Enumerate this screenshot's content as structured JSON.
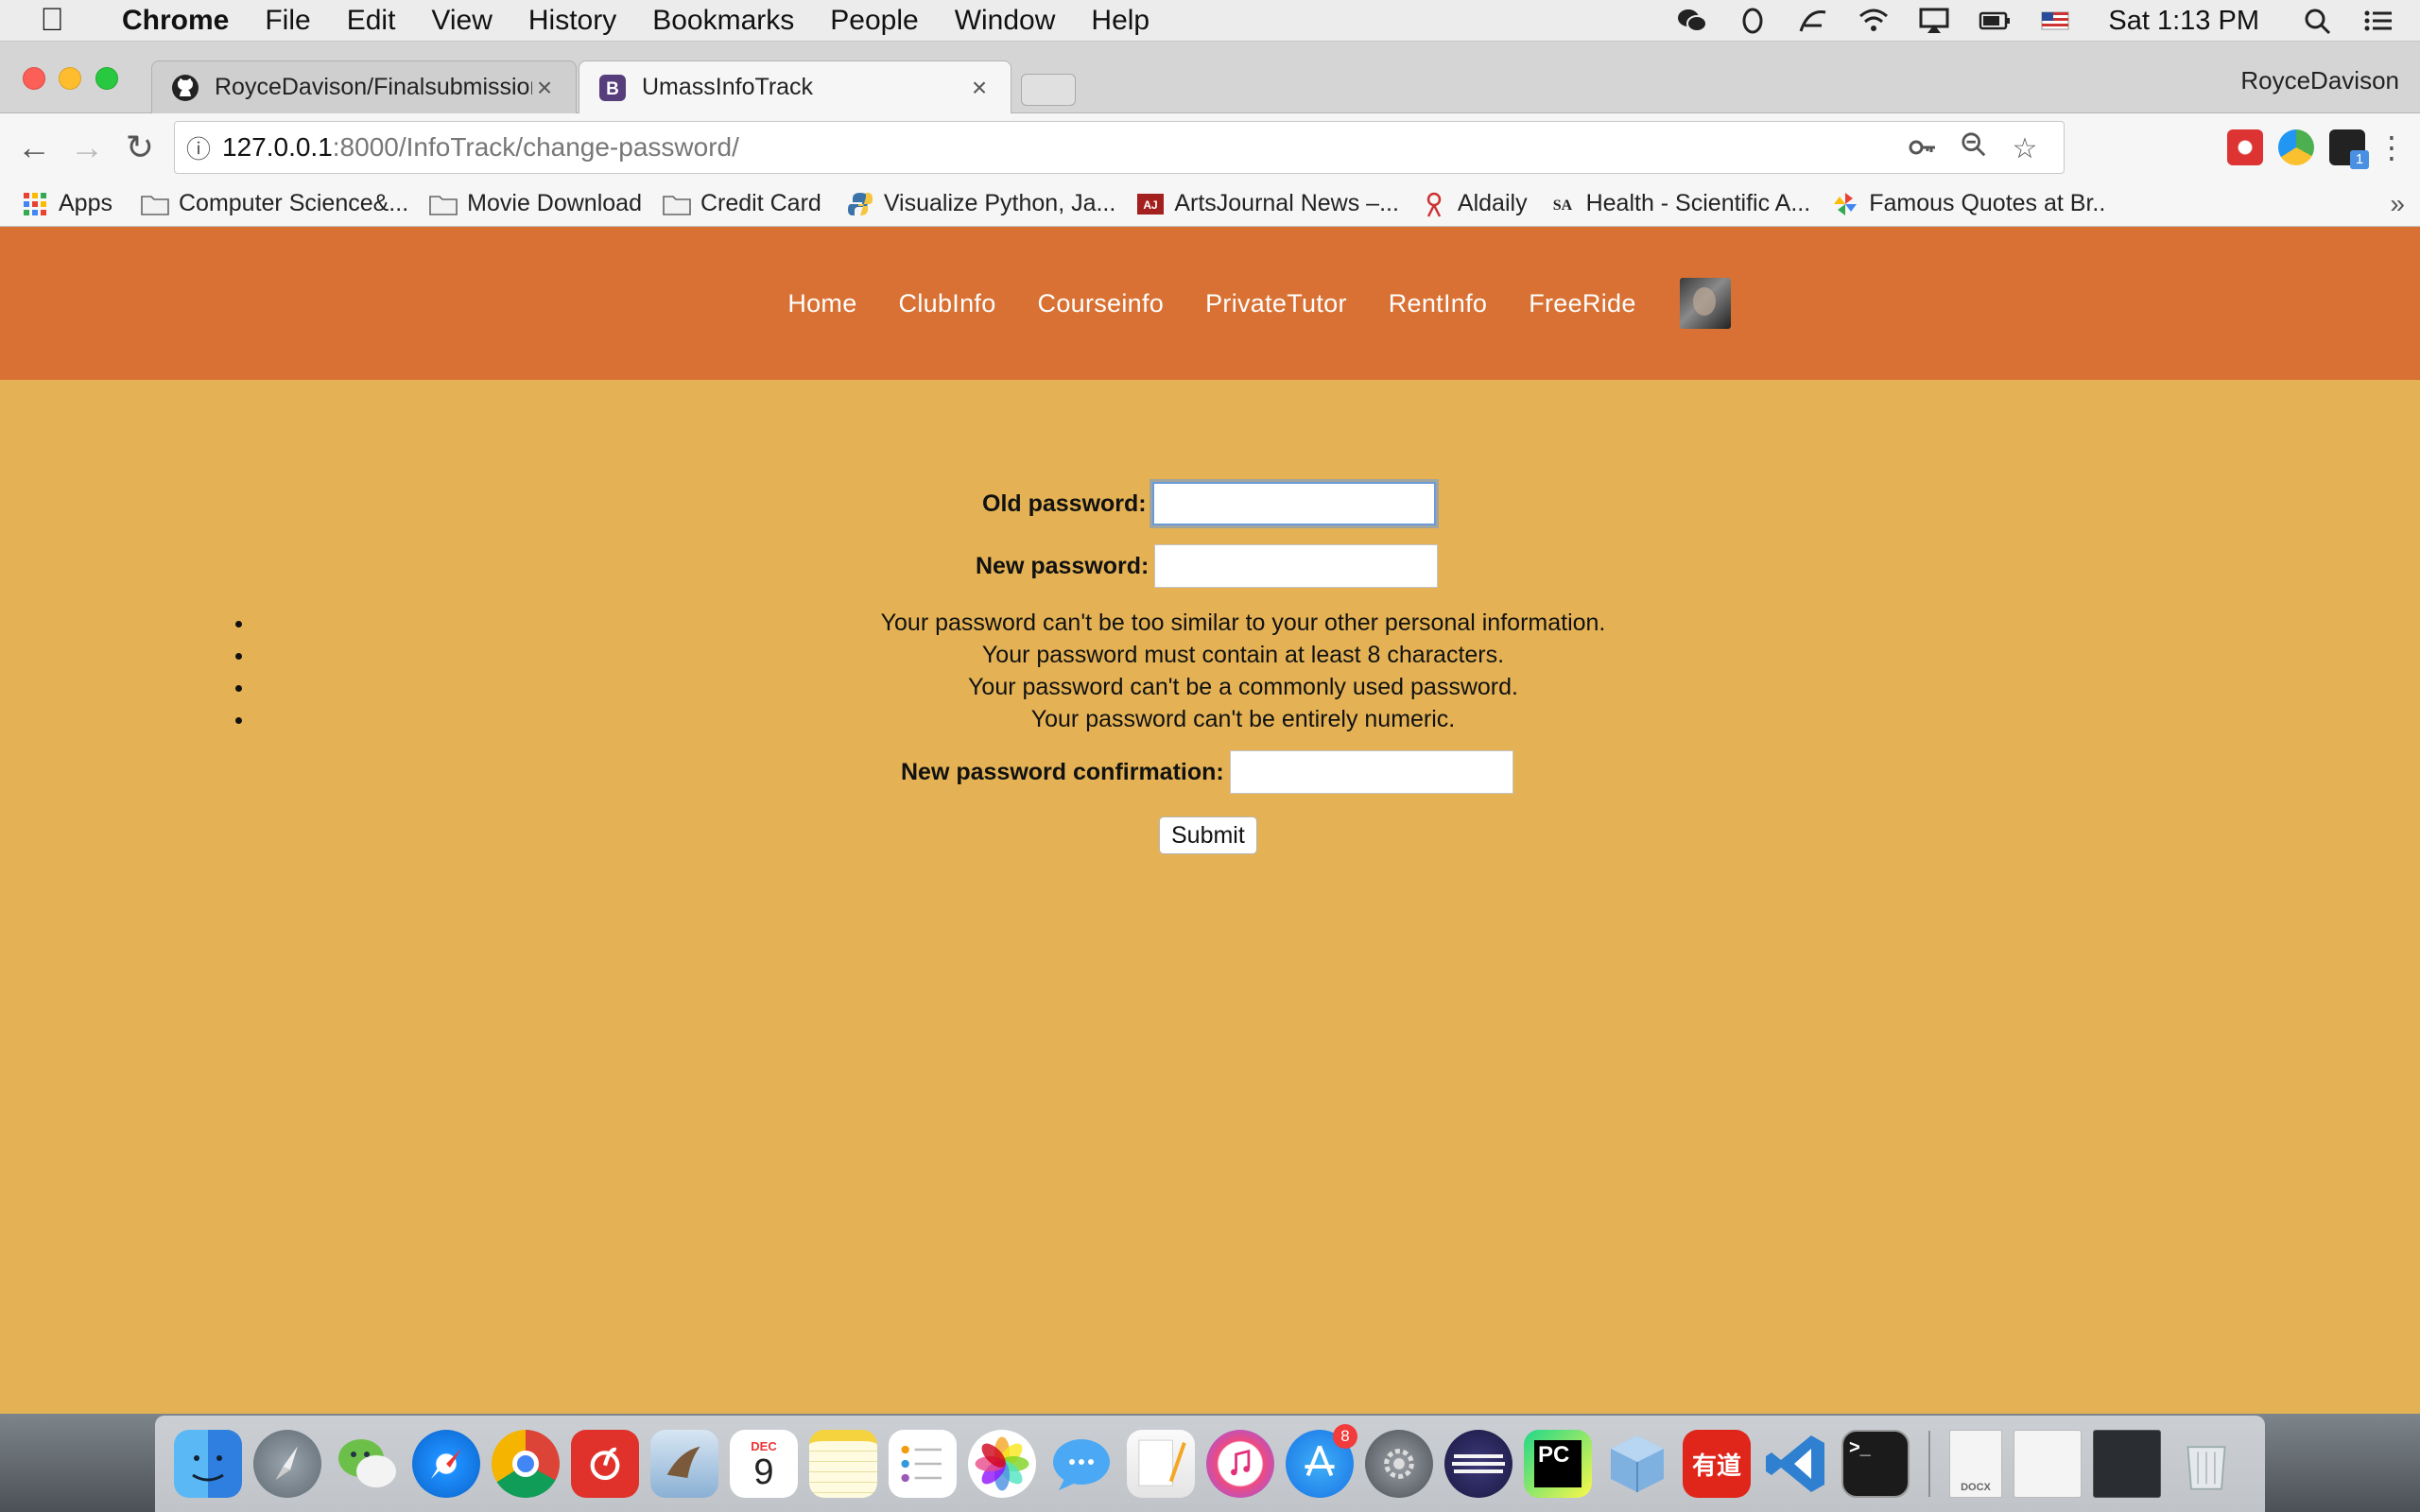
{
  "menubar": {
    "apple_icon": "apple-logo-icon",
    "app_name": "Chrome",
    "items": [
      "File",
      "Edit",
      "View",
      "History",
      "Bookmarks",
      "People",
      "Window",
      "Help"
    ],
    "clock": "Sat 1:13 PM",
    "status_icons": [
      "wechat-icon",
      "qq-icon",
      "pen-icon",
      "wifi-icon",
      "airplay-icon",
      "battery-icon",
      "us-flag-icon",
      "spotlight-search-icon",
      "notification-list-icon"
    ]
  },
  "browser": {
    "tabs": [
      {
        "title": "RoyceDavison/Finalsubmission",
        "icon": "github-icon"
      },
      {
        "title": "UmassInfoTrack",
        "icon": "bootstrap-icon"
      }
    ],
    "profile_name": "RoyceDavison",
    "address": {
      "host": "127.0.0.1",
      "path": ":8000/InfoTrack/change-password/"
    },
    "bookmarks": [
      {
        "label": "Apps",
        "icon": "apps-grid-icon"
      },
      {
        "label": "Computer Science&...",
        "icon": "folder-icon"
      },
      {
        "label": "Movie Download",
        "icon": "folder-icon"
      },
      {
        "label": "Credit Card",
        "icon": "folder-icon"
      },
      {
        "label": "Visualize Python, Ja...",
        "icon": "python-icon"
      },
      {
        "label": "ArtsJournal News –...",
        "icon": "artsjournal-icon"
      },
      {
        "label": "Aldaily",
        "icon": "aldaily-icon"
      },
      {
        "label": "Health - Scientific A...",
        "icon": "scientific-american-icon"
      },
      {
        "label": "Famous Quotes at Br..",
        "icon": "pinwheel-icon"
      }
    ]
  },
  "site": {
    "nav": [
      "Home",
      "ClubInfo",
      "Courseinfo",
      "PrivateTutor",
      "RentInfo",
      "FreeRide"
    ],
    "colors": {
      "nav_bg": "#d87133",
      "page_bg": "#e4b254"
    }
  },
  "form": {
    "old_password_label": "Old password:",
    "new_password_label": "New password:",
    "help_items": [
      "Your password can't be too similar to your other personal information.",
      "Your password must contain at least 8 characters.",
      "Your password can't be a commonly used password.",
      "Your password can't be entirely numeric."
    ],
    "confirm_label": "New password confirmation:",
    "submit_label": "Submit"
  },
  "dock": {
    "items": [
      "finder",
      "launchpad",
      "wechat",
      "safari",
      "chrome",
      "netease-music",
      "mail",
      "calendar",
      "notes",
      "reminders",
      "photos",
      "messages",
      "pages",
      "itunes",
      "app-store",
      "system-preferences",
      "eclipse",
      "pycharm",
      "virtualbox",
      "youdao",
      "vscode",
      "terminal"
    ],
    "calendar_month": "DEC",
    "calendar_day": "9",
    "app_store_badge": "8",
    "pycharm_label": "PC",
    "youdao_label": "有道",
    "terminal_label": ">_",
    "docx_label": "DOCX"
  }
}
